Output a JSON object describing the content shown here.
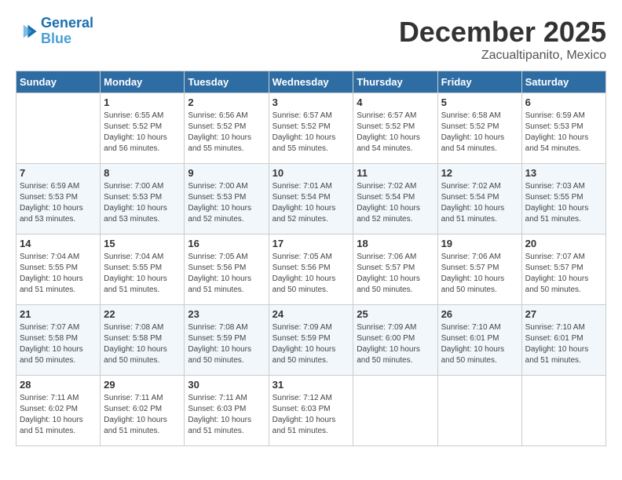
{
  "header": {
    "logo_line1": "General",
    "logo_line2": "Blue",
    "month": "December 2025",
    "location": "Zacualtipanito, Mexico"
  },
  "weekdays": [
    "Sunday",
    "Monday",
    "Tuesday",
    "Wednesday",
    "Thursday",
    "Friday",
    "Saturday"
  ],
  "weeks": [
    [
      {
        "day": "",
        "sunrise": "",
        "sunset": "",
        "daylight": ""
      },
      {
        "day": "1",
        "sunrise": "6:55 AM",
        "sunset": "5:52 PM",
        "daylight": "10 hours and 56 minutes."
      },
      {
        "day": "2",
        "sunrise": "6:56 AM",
        "sunset": "5:52 PM",
        "daylight": "10 hours and 55 minutes."
      },
      {
        "day": "3",
        "sunrise": "6:57 AM",
        "sunset": "5:52 PM",
        "daylight": "10 hours and 55 minutes."
      },
      {
        "day": "4",
        "sunrise": "6:57 AM",
        "sunset": "5:52 PM",
        "daylight": "10 hours and 54 minutes."
      },
      {
        "day": "5",
        "sunrise": "6:58 AM",
        "sunset": "5:52 PM",
        "daylight": "10 hours and 54 minutes."
      },
      {
        "day": "6",
        "sunrise": "6:59 AM",
        "sunset": "5:53 PM",
        "daylight": "10 hours and 54 minutes."
      }
    ],
    [
      {
        "day": "7",
        "sunrise": "6:59 AM",
        "sunset": "5:53 PM",
        "daylight": "10 hours and 53 minutes."
      },
      {
        "day": "8",
        "sunrise": "7:00 AM",
        "sunset": "5:53 PM",
        "daylight": "10 hours and 53 minutes."
      },
      {
        "day": "9",
        "sunrise": "7:00 AM",
        "sunset": "5:53 PM",
        "daylight": "10 hours and 52 minutes."
      },
      {
        "day": "10",
        "sunrise": "7:01 AM",
        "sunset": "5:54 PM",
        "daylight": "10 hours and 52 minutes."
      },
      {
        "day": "11",
        "sunrise": "7:02 AM",
        "sunset": "5:54 PM",
        "daylight": "10 hours and 52 minutes."
      },
      {
        "day": "12",
        "sunrise": "7:02 AM",
        "sunset": "5:54 PM",
        "daylight": "10 hours and 51 minutes."
      },
      {
        "day": "13",
        "sunrise": "7:03 AM",
        "sunset": "5:55 PM",
        "daylight": "10 hours and 51 minutes."
      }
    ],
    [
      {
        "day": "14",
        "sunrise": "7:04 AM",
        "sunset": "5:55 PM",
        "daylight": "10 hours and 51 minutes."
      },
      {
        "day": "15",
        "sunrise": "7:04 AM",
        "sunset": "5:55 PM",
        "daylight": "10 hours and 51 minutes."
      },
      {
        "day": "16",
        "sunrise": "7:05 AM",
        "sunset": "5:56 PM",
        "daylight": "10 hours and 51 minutes."
      },
      {
        "day": "17",
        "sunrise": "7:05 AM",
        "sunset": "5:56 PM",
        "daylight": "10 hours and 50 minutes."
      },
      {
        "day": "18",
        "sunrise": "7:06 AM",
        "sunset": "5:57 PM",
        "daylight": "10 hours and 50 minutes."
      },
      {
        "day": "19",
        "sunrise": "7:06 AM",
        "sunset": "5:57 PM",
        "daylight": "10 hours and 50 minutes."
      },
      {
        "day": "20",
        "sunrise": "7:07 AM",
        "sunset": "5:57 PM",
        "daylight": "10 hours and 50 minutes."
      }
    ],
    [
      {
        "day": "21",
        "sunrise": "7:07 AM",
        "sunset": "5:58 PM",
        "daylight": "10 hours and 50 minutes."
      },
      {
        "day": "22",
        "sunrise": "7:08 AM",
        "sunset": "5:58 PM",
        "daylight": "10 hours and 50 minutes."
      },
      {
        "day": "23",
        "sunrise": "7:08 AM",
        "sunset": "5:59 PM",
        "daylight": "10 hours and 50 minutes."
      },
      {
        "day": "24",
        "sunrise": "7:09 AM",
        "sunset": "5:59 PM",
        "daylight": "10 hours and 50 minutes."
      },
      {
        "day": "25",
        "sunrise": "7:09 AM",
        "sunset": "6:00 PM",
        "daylight": "10 hours and 50 minutes."
      },
      {
        "day": "26",
        "sunrise": "7:10 AM",
        "sunset": "6:01 PM",
        "daylight": "10 hours and 50 minutes."
      },
      {
        "day": "27",
        "sunrise": "7:10 AM",
        "sunset": "6:01 PM",
        "daylight": "10 hours and 51 minutes."
      }
    ],
    [
      {
        "day": "28",
        "sunrise": "7:11 AM",
        "sunset": "6:02 PM",
        "daylight": "10 hours and 51 minutes."
      },
      {
        "day": "29",
        "sunrise": "7:11 AM",
        "sunset": "6:02 PM",
        "daylight": "10 hours and 51 minutes."
      },
      {
        "day": "30",
        "sunrise": "7:11 AM",
        "sunset": "6:03 PM",
        "daylight": "10 hours and 51 minutes."
      },
      {
        "day": "31",
        "sunrise": "7:12 AM",
        "sunset": "6:03 PM",
        "daylight": "10 hours and 51 minutes."
      },
      {
        "day": "",
        "sunrise": "",
        "sunset": "",
        "daylight": ""
      },
      {
        "day": "",
        "sunrise": "",
        "sunset": "",
        "daylight": ""
      },
      {
        "day": "",
        "sunrise": "",
        "sunset": "",
        "daylight": ""
      }
    ]
  ]
}
